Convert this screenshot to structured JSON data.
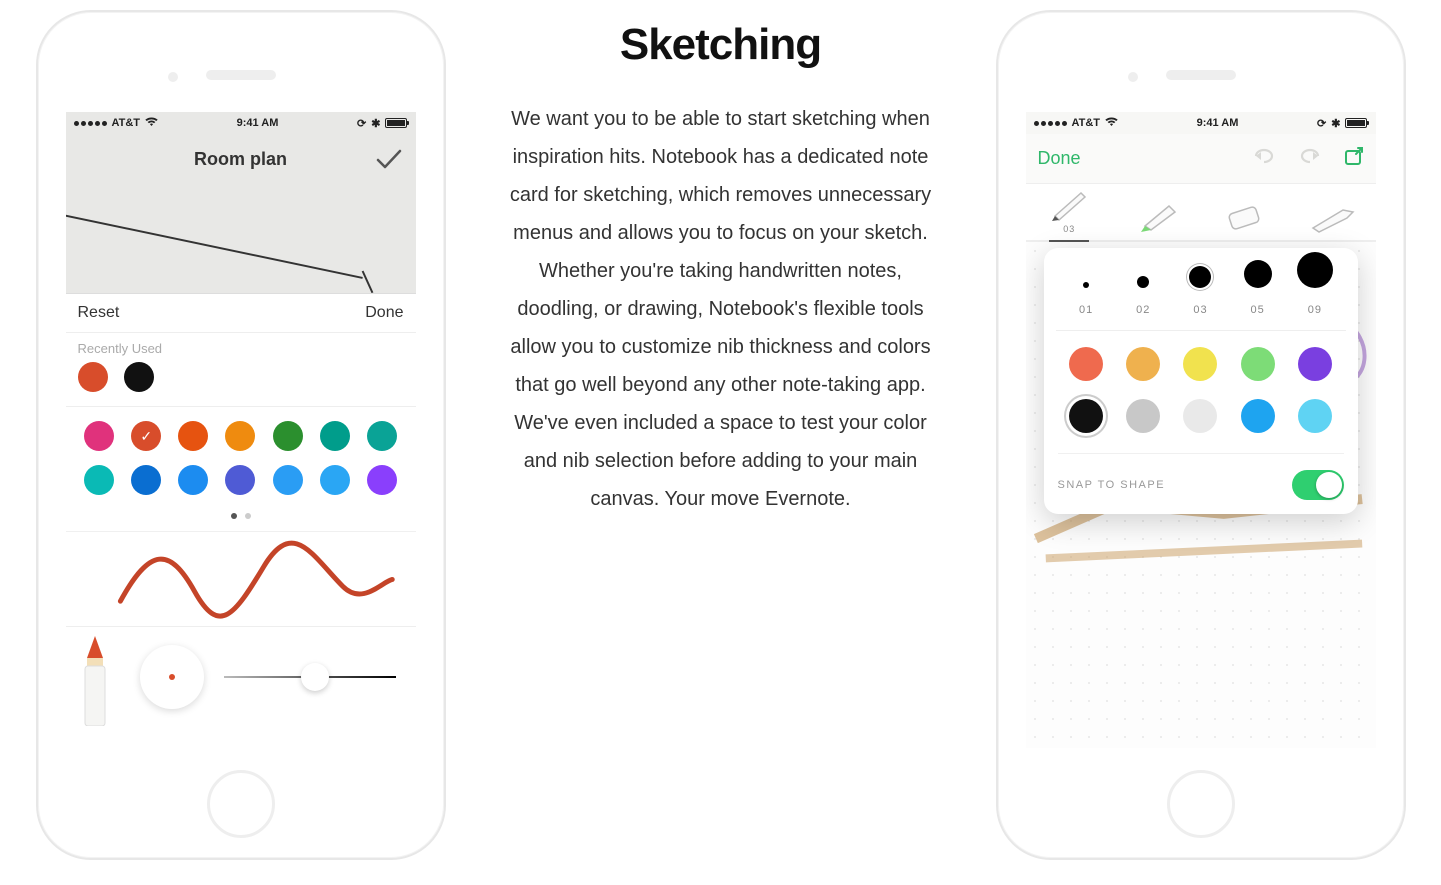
{
  "center": {
    "heading": "Sketching",
    "paragraph": "We want you to be able to start sketching when inspiration hits. Notebook has a dedicated note card for sketching, which removes unnecessary menus and allows you to focus on your sketch. Whether you're taking handwritten notes, doodling, or drawing, Notebook's flexible tools allow you to customize nib thickness and colors that go well beyond any other note-taking app. We've even included a space to test your color and nib selection before adding to your main canvas. Your move Evernote."
  },
  "statusbar": {
    "carrier": "AT&T",
    "time": "9:41 AM"
  },
  "screen1": {
    "title": "Room plan",
    "reset": "Reset",
    "done": "Done",
    "recently_used_label": "Recently Used",
    "recent_colors": [
      "#d84d2b",
      "#111111"
    ],
    "palette_row1": [
      "#e0327c",
      "#d84d2b",
      "#e65310",
      "#ef8b0f",
      "#2b8f2e",
      "#009d8b",
      "#0aa396"
    ],
    "palette_row2": [
      "#0abab5",
      "#0a6ed1",
      "#1c8cf0",
      "#4f5bd5",
      "#2a9df4",
      "#2aa6f4",
      "#8a3ffc"
    ],
    "selected_index": 1,
    "test_stroke_color": "#c44428",
    "pencil_color": "#d84d2b",
    "nib_preview_color": "#d84d2b"
  },
  "screen2": {
    "done": "Done",
    "tool_selected_label": "03",
    "selected_tool_index": 0,
    "sizes": [
      {
        "label": "01",
        "d": 6
      },
      {
        "label": "02",
        "d": 12
      },
      {
        "label": "03",
        "d": 22,
        "selected": true
      },
      {
        "label": "05",
        "d": 28
      },
      {
        "label": "09",
        "d": 36
      }
    ],
    "colors_row1": [
      "#ef6a4e",
      "#efb14e",
      "#f1e24e",
      "#7ddc77",
      "#7a3fe0"
    ],
    "colors_row2": [
      "#111111",
      "#c8c8c8",
      "#e9e9e9",
      "#1ea4f0",
      "#5fd3f3"
    ],
    "selected_color_index": 5,
    "snap_label": "SNAP TO SHAPE",
    "snap_on": true,
    "highlighter_color": "#7cd977",
    "accent_color": "#2fb76a"
  }
}
